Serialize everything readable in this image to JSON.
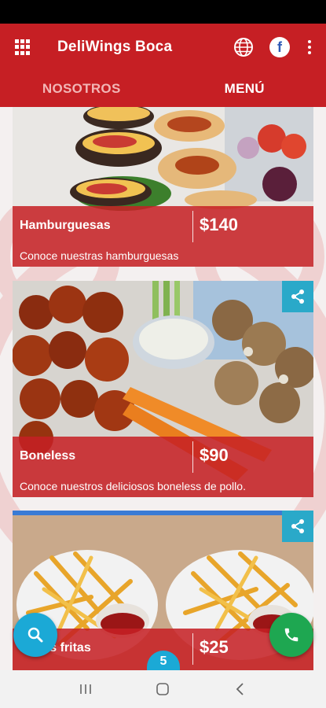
{
  "appbar": {
    "title": "DeliWings Boca",
    "menu_icon": "grid-menu-icon",
    "language_icon": "globe-icon",
    "facebook_icon": "facebook-icon",
    "facebook_letter": "f",
    "more_icon": "more-vert-icon"
  },
  "tabs": [
    {
      "label": "NOSOTROS",
      "active": false
    },
    {
      "label": "MENÚ",
      "active": true
    }
  ],
  "menu_items": [
    {
      "name": "Hamburguesas",
      "price": "$140",
      "description": "Conoce nuestras hamburguesas"
    },
    {
      "name": "Boneless",
      "price": "$90",
      "description": "Conoce nuestros deliciosos boneless de pollo."
    },
    {
      "name": "Papas fritas",
      "price": "$25",
      "description": ""
    }
  ],
  "fab": {
    "search_icon": "search-icon",
    "call_icon": "phone-icon",
    "cart_count": "5"
  },
  "colors": {
    "primary": "#c61f24",
    "tab_inactive": "#f2b6b6",
    "accent_blue": "#1ba9d6",
    "call_green": "#1ea751"
  },
  "system_nav": [
    "recents-icon",
    "home-icon",
    "back-icon"
  ]
}
